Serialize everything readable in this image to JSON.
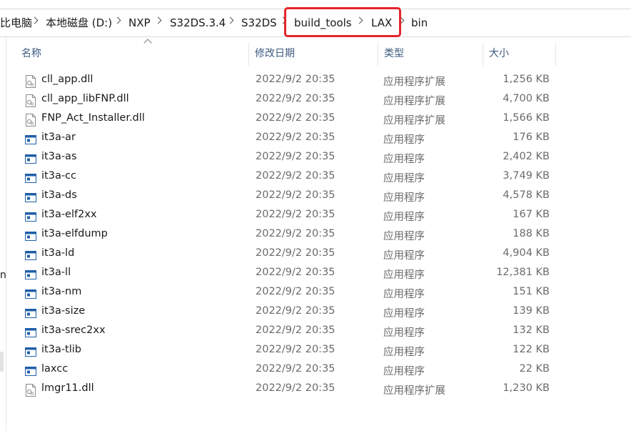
{
  "breadcrumb": [
    "比电脑",
    "本地磁盘 (D:)",
    "NXP",
    "S32DS.3.4",
    "S32DS",
    "build_tools",
    "LAX",
    "bin"
  ],
  "left_pane": {
    "glyph": "n"
  },
  "columns": {
    "name": "名称",
    "date": "修改日期",
    "type": "类型",
    "size": "大小"
  },
  "files": [
    {
      "name": "cll_app.dll",
      "date": "2022/9/2 20:35",
      "type": "应用程序扩展",
      "size": "1,256 KB",
      "icon": "dll-icon"
    },
    {
      "name": "cll_app_libFNP.dll",
      "date": "2022/9/2 20:35",
      "type": "应用程序扩展",
      "size": "4,700 KB",
      "icon": "dll-icon"
    },
    {
      "name": "FNP_Act_Installer.dll",
      "date": "2022/9/2 20:35",
      "type": "应用程序扩展",
      "size": "1,566 KB",
      "icon": "dll-icon"
    },
    {
      "name": "it3a-ar",
      "date": "2022/9/2 20:35",
      "type": "应用程序",
      "size": "176 KB",
      "icon": "exe-icon"
    },
    {
      "name": "it3a-as",
      "date": "2022/9/2 20:35",
      "type": "应用程序",
      "size": "2,402 KB",
      "icon": "exe-icon"
    },
    {
      "name": "it3a-cc",
      "date": "2022/9/2 20:35",
      "type": "应用程序",
      "size": "3,749 KB",
      "icon": "exe-icon"
    },
    {
      "name": "it3a-ds",
      "date": "2022/9/2 20:35",
      "type": "应用程序",
      "size": "4,578 KB",
      "icon": "exe-icon"
    },
    {
      "name": "it3a-elf2xx",
      "date": "2022/9/2 20:35",
      "type": "应用程序",
      "size": "167 KB",
      "icon": "exe-icon"
    },
    {
      "name": "it3a-elfdump",
      "date": "2022/9/2 20:35",
      "type": "应用程序",
      "size": "188 KB",
      "icon": "exe-icon"
    },
    {
      "name": "it3a-ld",
      "date": "2022/9/2 20:35",
      "type": "应用程序",
      "size": "4,904 KB",
      "icon": "exe-icon"
    },
    {
      "name": "it3a-ll",
      "date": "2022/9/2 20:35",
      "type": "应用程序",
      "size": "12,381 KB",
      "icon": "exe-icon"
    },
    {
      "name": "it3a-nm",
      "date": "2022/9/2 20:35",
      "type": "应用程序",
      "size": "151 KB",
      "icon": "exe-icon"
    },
    {
      "name": "it3a-size",
      "date": "2022/9/2 20:35",
      "type": "应用程序",
      "size": "139 KB",
      "icon": "exe-icon"
    },
    {
      "name": "it3a-srec2xx",
      "date": "2022/9/2 20:35",
      "type": "应用程序",
      "size": "132 KB",
      "icon": "exe-icon"
    },
    {
      "name": "it3a-tlib",
      "date": "2022/9/2 20:35",
      "type": "应用程序",
      "size": "122 KB",
      "icon": "exe-icon"
    },
    {
      "name": "laxcc",
      "date": "2022/9/2 20:35",
      "type": "应用程序",
      "size": "22 KB",
      "icon": "exe-icon"
    },
    {
      "name": "lmgr11.dll",
      "date": "2022/9/2 20:35",
      "type": "应用程序扩展",
      "size": "1,230 KB",
      "icon": "dll-icon"
    }
  ],
  "colors": {
    "highlight_box": "#e5242b",
    "header_text": "#3d5a80",
    "exe_icon": "#1f5fa8"
  }
}
